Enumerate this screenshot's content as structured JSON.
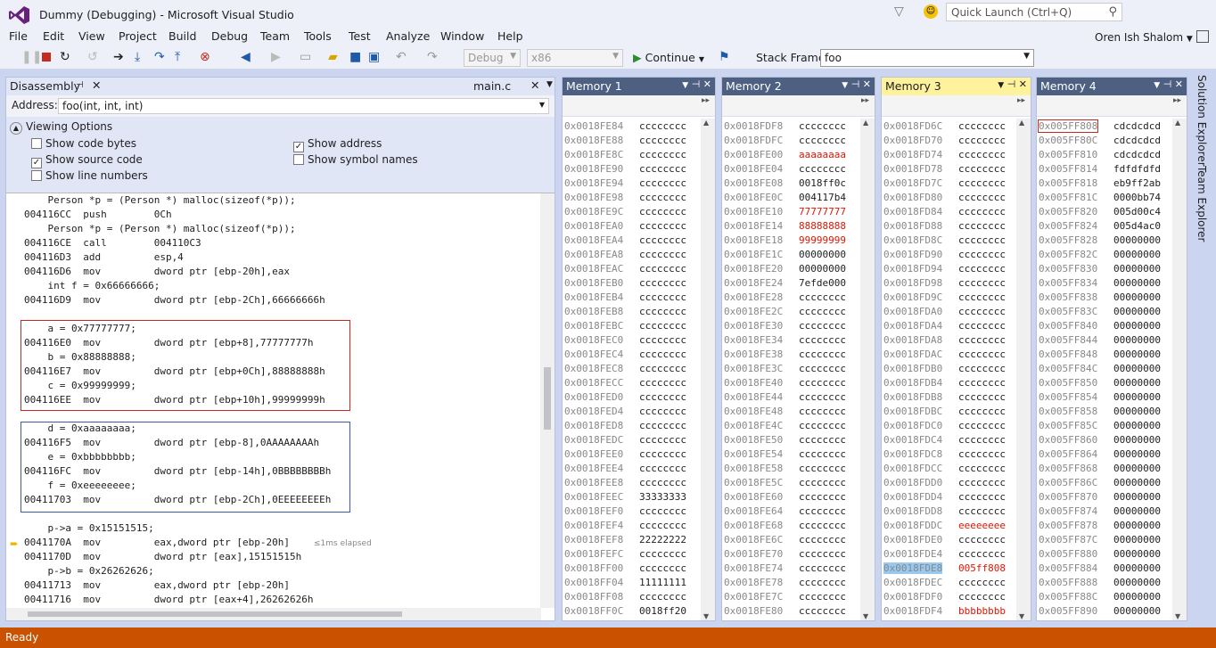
{
  "window": {
    "title": "Dummy (Debugging) - Microsoft Visual Studio",
    "quick_launch_placeholder": "Quick Launch (Ctrl+Q)",
    "user": "Oren Ish Shalom"
  },
  "menu": [
    "File",
    "Edit",
    "View",
    "Project",
    "Build",
    "Debug",
    "Team",
    "Tools",
    "Test",
    "Analyze",
    "Window",
    "Help"
  ],
  "toolbar": {
    "config": "Debug",
    "platform": "x86",
    "continue_label": "Continue",
    "stack_frame_label": "Stack Frame:",
    "stack_frame_value": "foo"
  },
  "disassembly": {
    "tab": "Disassembly",
    "file_tab": "main.c",
    "address_label": "Address:",
    "address_value": "foo(int, int, int)",
    "viewing_options": "Viewing Options",
    "options": [
      {
        "label": "Show code bytes",
        "checked": false
      },
      {
        "label": "Show source code",
        "checked": true
      },
      {
        "label": "Show line numbers",
        "checked": false
      },
      {
        "label": "Show address",
        "checked": true
      },
      {
        "label": "Show symbol names",
        "checked": false
      }
    ],
    "elapsed": "≤1ms elapsed",
    "lines": [
      "    Person *p = (Person *) malloc(sizeof(*p));",
      "004116CC  push        0Ch",
      "    Person *p = (Person *) malloc(sizeof(*p));",
      "004116CE  call        004110C3",
      "004116D3  add         esp,4",
      "004116D6  mov         dword ptr [ebp-20h],eax",
      "    int f = 0x66666666;",
      "004116D9  mov         dword ptr [ebp-2Ch],66666666h",
      "",
      "    a = 0x77777777;",
      "004116E0  mov         dword ptr [ebp+8],77777777h",
      "    b = 0x88888888;",
      "004116E7  mov         dword ptr [ebp+0Ch],88888888h",
      "    c = 0x99999999;",
      "004116EE  mov         dword ptr [ebp+10h],99999999h",
      "",
      "    d = 0xaaaaaaaa;",
      "004116F5  mov         dword ptr [ebp-8],0AAAAAAAAh",
      "    e = 0xbbbbbbbb;",
      "004116FC  mov         dword ptr [ebp-14h],0BBBBBBBBh",
      "    f = 0xeeeeeeee;",
      "00411703  mov         dword ptr [ebp-2Ch],0EEEEEEEEh",
      "",
      "    p->a = 0x15151515;",
      "0041170A  mov         eax,dword ptr [ebp-20h]",
      "0041170D  mov         dword ptr [eax],15151515h",
      "    p->b = 0x26262626;",
      "00411713  mov         eax,dword ptr [ebp-20h]",
      "00411716  mov         dword ptr [eax+4],26262626h"
    ]
  },
  "memory_windows": [
    {
      "title": "Memory 1",
      "rows": [
        [
          "0x0018FE84",
          "cccccccc",
          0
        ],
        [
          "0x0018FE88",
          "cccccccc",
          0
        ],
        [
          "0x0018FE8C",
          "cccccccc",
          0
        ],
        [
          "0x0018FE90",
          "cccccccc",
          0
        ],
        [
          "0x0018FE94",
          "cccccccc",
          0
        ],
        [
          "0x0018FE98",
          "cccccccc",
          0
        ],
        [
          "0x0018FE9C",
          "cccccccc",
          0
        ],
        [
          "0x0018FEA0",
          "cccccccc",
          0
        ],
        [
          "0x0018FEA4",
          "cccccccc",
          0
        ],
        [
          "0x0018FEA8",
          "cccccccc",
          0
        ],
        [
          "0x0018FEAC",
          "cccccccc",
          0
        ],
        [
          "0x0018FEB0",
          "cccccccc",
          0
        ],
        [
          "0x0018FEB4",
          "cccccccc",
          0
        ],
        [
          "0x0018FEB8",
          "cccccccc",
          0
        ],
        [
          "0x0018FEBC",
          "cccccccc",
          0
        ],
        [
          "0x0018FEC0",
          "cccccccc",
          0
        ],
        [
          "0x0018FEC4",
          "cccccccc",
          0
        ],
        [
          "0x0018FEC8",
          "cccccccc",
          0
        ],
        [
          "0x0018FECC",
          "cccccccc",
          0
        ],
        [
          "0x0018FED0",
          "cccccccc",
          0
        ],
        [
          "0x0018FED4",
          "cccccccc",
          0
        ],
        [
          "0x0018FED8",
          "cccccccc",
          0
        ],
        [
          "0x0018FEDC",
          "cccccccc",
          0
        ],
        [
          "0x0018FEE0",
          "cccccccc",
          0
        ],
        [
          "0x0018FEE4",
          "cccccccc",
          0
        ],
        [
          "0x0018FEE8",
          "cccccccc",
          0
        ],
        [
          "0x0018FEEC",
          "33333333",
          0
        ],
        [
          "0x0018FEF0",
          "cccccccc",
          0
        ],
        [
          "0x0018FEF4",
          "cccccccc",
          0
        ],
        [
          "0x0018FEF8",
          "22222222",
          0
        ],
        [
          "0x0018FEFC",
          "cccccccc",
          0
        ],
        [
          "0x0018FF00",
          "cccccccc",
          0
        ],
        [
          "0x0018FF04",
          "11111111",
          0
        ],
        [
          "0x0018FF08",
          "cccccccc",
          0
        ],
        [
          "0x0018FF0C",
          "0018ff20",
          0
        ]
      ]
    },
    {
      "title": "Memory 2",
      "rows": [
        [
          "0x0018FDF8",
          "cccccccc",
          0
        ],
        [
          "0x0018FDFC",
          "cccccccc",
          0
        ],
        [
          "0x0018FE00",
          "aaaaaaaa",
          1
        ],
        [
          "0x0018FE04",
          "cccccccc",
          0
        ],
        [
          "0x0018FE08",
          "0018ff0c",
          0
        ],
        [
          "0x0018FE0C",
          "004117b4",
          0
        ],
        [
          "0x0018FE10",
          "77777777",
          1
        ],
        [
          "0x0018FE14",
          "88888888",
          1
        ],
        [
          "0x0018FE18",
          "99999999",
          1
        ],
        [
          "0x0018FE1C",
          "00000000",
          0
        ],
        [
          "0x0018FE20",
          "00000000",
          0
        ],
        [
          "0x0018FE24",
          "7efde000",
          0
        ],
        [
          "0x0018FE28",
          "cccccccc",
          0
        ],
        [
          "0x0018FE2C",
          "cccccccc",
          0
        ],
        [
          "0x0018FE30",
          "cccccccc",
          0
        ],
        [
          "0x0018FE34",
          "cccccccc",
          0
        ],
        [
          "0x0018FE38",
          "cccccccc",
          0
        ],
        [
          "0x0018FE3C",
          "cccccccc",
          0
        ],
        [
          "0x0018FE40",
          "cccccccc",
          0
        ],
        [
          "0x0018FE44",
          "cccccccc",
          0
        ],
        [
          "0x0018FE48",
          "cccccccc",
          0
        ],
        [
          "0x0018FE4C",
          "cccccccc",
          0
        ],
        [
          "0x0018FE50",
          "cccccccc",
          0
        ],
        [
          "0x0018FE54",
          "cccccccc",
          0
        ],
        [
          "0x0018FE58",
          "cccccccc",
          0
        ],
        [
          "0x0018FE5C",
          "cccccccc",
          0
        ],
        [
          "0x0018FE60",
          "cccccccc",
          0
        ],
        [
          "0x0018FE64",
          "cccccccc",
          0
        ],
        [
          "0x0018FE68",
          "cccccccc",
          0
        ],
        [
          "0x0018FE6C",
          "cccccccc",
          0
        ],
        [
          "0x0018FE70",
          "cccccccc",
          0
        ],
        [
          "0x0018FE74",
          "cccccccc",
          0
        ],
        [
          "0x0018FE78",
          "cccccccc",
          0
        ],
        [
          "0x0018FE7C",
          "cccccccc",
          0
        ],
        [
          "0x0018FE80",
          "cccccccc",
          0
        ]
      ]
    },
    {
      "title": "Memory 3",
      "active": true,
      "rows": [
        [
          "0x0018FD6C",
          "cccccccc",
          0
        ],
        [
          "0x0018FD70",
          "cccccccc",
          0
        ],
        [
          "0x0018FD74",
          "cccccccc",
          0
        ],
        [
          "0x0018FD78",
          "cccccccc",
          0
        ],
        [
          "0x0018FD7C",
          "cccccccc",
          0
        ],
        [
          "0x0018FD80",
          "cccccccc",
          0
        ],
        [
          "0x0018FD84",
          "cccccccc",
          0
        ],
        [
          "0x0018FD88",
          "cccccccc",
          0
        ],
        [
          "0x0018FD8C",
          "cccccccc",
          0
        ],
        [
          "0x0018FD90",
          "cccccccc",
          0
        ],
        [
          "0x0018FD94",
          "cccccccc",
          0
        ],
        [
          "0x0018FD98",
          "cccccccc",
          0
        ],
        [
          "0x0018FD9C",
          "cccccccc",
          0
        ],
        [
          "0x0018FDA0",
          "cccccccc",
          0
        ],
        [
          "0x0018FDA4",
          "cccccccc",
          0
        ],
        [
          "0x0018FDA8",
          "cccccccc",
          0
        ],
        [
          "0x0018FDAC",
          "cccccccc",
          0
        ],
        [
          "0x0018FDB0",
          "cccccccc",
          0
        ],
        [
          "0x0018FDB4",
          "cccccccc",
          0
        ],
        [
          "0x0018FDB8",
          "cccccccc",
          0
        ],
        [
          "0x0018FDBC",
          "cccccccc",
          0
        ],
        [
          "0x0018FDC0",
          "cccccccc",
          0
        ],
        [
          "0x0018FDC4",
          "cccccccc",
          0
        ],
        [
          "0x0018FDC8",
          "cccccccc",
          0
        ],
        [
          "0x0018FDCC",
          "cccccccc",
          0
        ],
        [
          "0x0018FDD0",
          "cccccccc",
          0
        ],
        [
          "0x0018FDD4",
          "cccccccc",
          0
        ],
        [
          "0x0018FDD8",
          "cccccccc",
          0
        ],
        [
          "0x0018FDDC",
          "eeeeeeee",
          1
        ],
        [
          "0x0018FDE0",
          "cccccccc",
          0
        ],
        [
          "0x0018FDE4",
          "cccccccc",
          0
        ],
        [
          "0x0018FDE8",
          "005ff808",
          1
        ],
        [
          "0x0018FDEC",
          "cccccccc",
          0
        ],
        [
          "0x0018FDF0",
          "cccccccc",
          0
        ],
        [
          "0x0018FDF4",
          "bbbbbbbb",
          1
        ]
      ]
    },
    {
      "title": "Memory 4",
      "rows": [
        [
          "0x005FF808",
          "cdcdcdcd",
          0
        ],
        [
          "0x005FF80C",
          "cdcdcdcd",
          0
        ],
        [
          "0x005FF810",
          "cdcdcdcd",
          0
        ],
        [
          "0x005FF814",
          "fdfdfdfd",
          0
        ],
        [
          "0x005FF818",
          "eb9ff2ab",
          0
        ],
        [
          "0x005FF81C",
          "0000bb74",
          0
        ],
        [
          "0x005FF820",
          "005d00c4",
          0
        ],
        [
          "0x005FF824",
          "005d4ac0",
          0
        ],
        [
          "0x005FF828",
          "00000000",
          0
        ],
        [
          "0x005FF82C",
          "00000000",
          0
        ],
        [
          "0x005FF830",
          "00000000",
          0
        ],
        [
          "0x005FF834",
          "00000000",
          0
        ],
        [
          "0x005FF838",
          "00000000",
          0
        ],
        [
          "0x005FF83C",
          "00000000",
          0
        ],
        [
          "0x005FF840",
          "00000000",
          0
        ],
        [
          "0x005FF844",
          "00000000",
          0
        ],
        [
          "0x005FF848",
          "00000000",
          0
        ],
        [
          "0x005FF84C",
          "00000000",
          0
        ],
        [
          "0x005FF850",
          "00000000",
          0
        ],
        [
          "0x005FF854",
          "00000000",
          0
        ],
        [
          "0x005FF858",
          "00000000",
          0
        ],
        [
          "0x005FF85C",
          "00000000",
          0
        ],
        [
          "0x005FF860",
          "00000000",
          0
        ],
        [
          "0x005FF864",
          "00000000",
          0
        ],
        [
          "0x005FF868",
          "00000000",
          0
        ],
        [
          "0x005FF86C",
          "00000000",
          0
        ],
        [
          "0x005FF870",
          "00000000",
          0
        ],
        [
          "0x005FF874",
          "00000000",
          0
        ],
        [
          "0x005FF878",
          "00000000",
          0
        ],
        [
          "0x005FF87C",
          "00000000",
          0
        ],
        [
          "0x005FF880",
          "00000000",
          0
        ],
        [
          "0x005FF884",
          "00000000",
          0
        ],
        [
          "0x005FF888",
          "00000000",
          0
        ],
        [
          "0x005FF88C",
          "00000000",
          0
        ],
        [
          "0x005FF890",
          "00000000",
          0
        ]
      ]
    }
  ],
  "side_tabs": [
    "Solution Explorer",
    "Team Explorer"
  ],
  "status": "Ready"
}
